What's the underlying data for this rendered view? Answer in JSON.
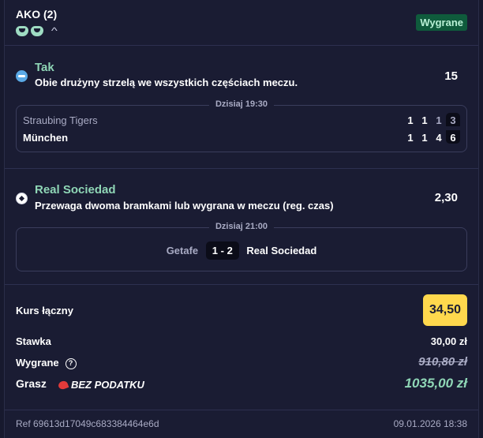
{
  "header": {
    "title": "AKO (2)",
    "status": "Wygrane"
  },
  "selections": [
    {
      "pick": "Tak",
      "market": "Obie drużyny strzelą we wszystkich częściach meczu.",
      "odds": "15",
      "time": "Dzisiaj 19:30",
      "home": "Straubing Tigers",
      "away": "München",
      "home_scores": [
        "1",
        "1",
        "1",
        "3"
      ],
      "away_scores": [
        "1",
        "1",
        "4",
        "6"
      ]
    },
    {
      "pick": "Real Sociedad",
      "market": "Przewaga dwoma bramkami lub wygrana w meczu (reg. czas)",
      "odds": "2,30",
      "time": "Dzisiaj 21:00",
      "home": "Getafe",
      "score": "1 - 2",
      "away": "Real Sociedad"
    }
  ],
  "summary": {
    "total_odds_label": "Kurs łączny",
    "total_odds": "34,50",
    "stake_label": "Stawka",
    "stake": "30,00 zł",
    "won_label": "Wygrane",
    "won_amount": "910,80 zł",
    "payout_label": "Grasz",
    "promo": "BEZ PODATKU",
    "payout": "1035,00 zł"
  },
  "footer": {
    "ref": "Ref 69613d17049c683384464e6d",
    "date": "09.01.2026 18:38"
  },
  "colors": {
    "accent_green": "#8fd6b6",
    "badge_bg": "#0f5b3c",
    "odds_yellow": "#ffd84d",
    "bg": "#1a1c33"
  },
  "icons": [
    "trophy-icon",
    "chevron-up-icon",
    "hockey-icon",
    "football-icon",
    "info-icon",
    "promo-flag-icon"
  ]
}
